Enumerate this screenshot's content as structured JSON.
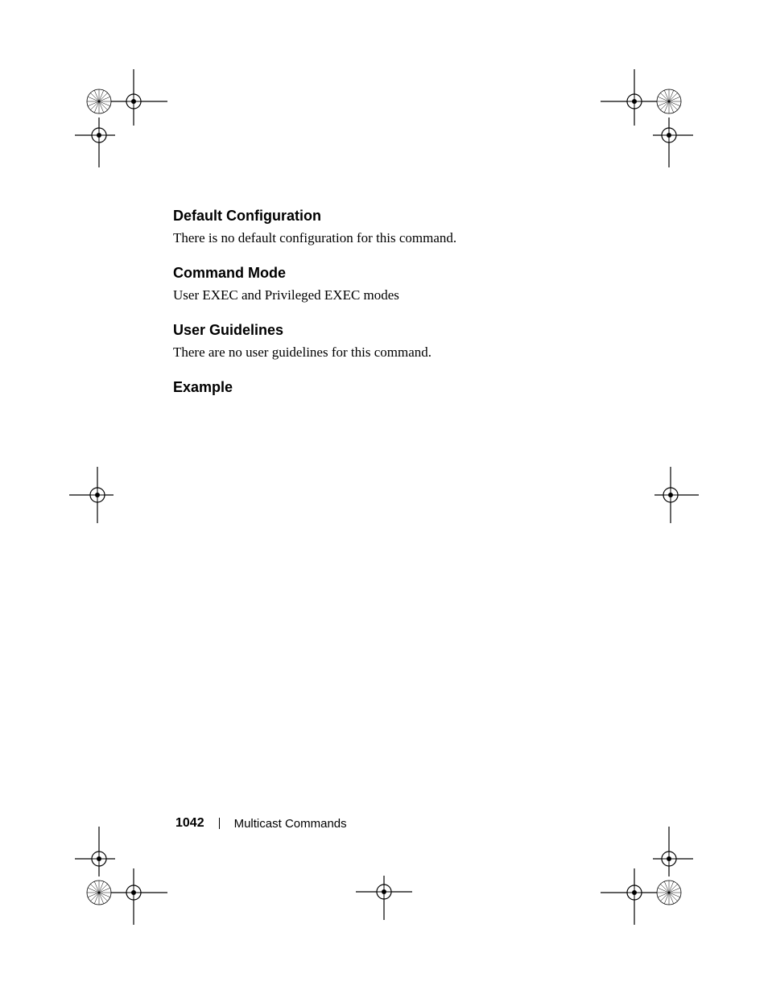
{
  "sections": {
    "default_config": {
      "heading": "Default Configuration",
      "body": "There is no default configuration for this command."
    },
    "command_mode": {
      "heading": "Command Mode",
      "body": "User EXEC and Privileged EXEC modes"
    },
    "user_guidelines": {
      "heading": "User Guidelines",
      "body": "There are no user guidelines for this command."
    },
    "example": {
      "heading": "Example"
    }
  },
  "footer": {
    "page_number": "1042",
    "chapter_title": "Multicast Commands"
  }
}
